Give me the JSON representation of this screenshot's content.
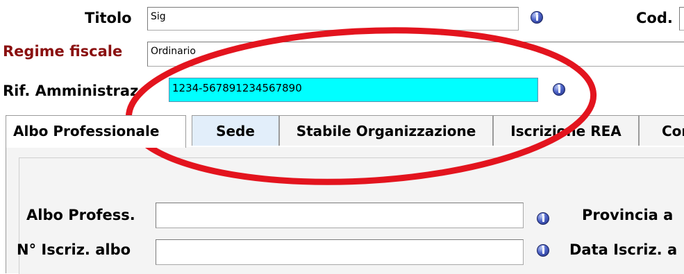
{
  "form": {
    "titolo_label": "Titolo",
    "titolo_value": "Sig",
    "cod_label": "Cod.",
    "regime_label": "Regime fiscale",
    "regime_value": "Ordinario",
    "rif_label": "Rif. Amministraz.",
    "rif_value": "1234-567891234567890"
  },
  "tabs": [
    {
      "label": "Albo Professionale",
      "active": true
    },
    {
      "label": "Sede",
      "active": false
    },
    {
      "label": "Stabile Organizzazione",
      "active": false
    },
    {
      "label": "Iscrizione REA",
      "active": false
    },
    {
      "label": "Cor",
      "active": false
    }
  ],
  "albo": {
    "albo_profess_label": "Albo Profess.",
    "albo_profess_value": "",
    "provincia_label": "Provincia a",
    "n_iscriz_label": "N° Iscriz. albo",
    "n_iscriz_value": "",
    "data_iscriz_label": "Data Iscriz. a"
  },
  "colors": {
    "highlight_field": "#00ffff",
    "annotation_ellipse": "#e3141e",
    "regime_label_color": "#8a1010"
  },
  "icons": [
    "info-icon"
  ]
}
